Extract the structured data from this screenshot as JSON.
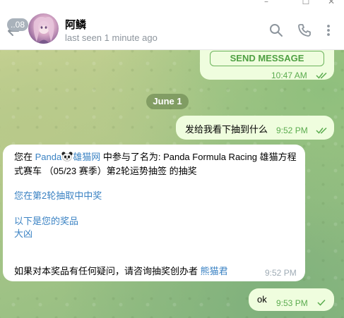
{
  "window": {
    "controls": [
      "–",
      "☐",
      "✕"
    ]
  },
  "header": {
    "unread_count": "..08",
    "chat_name": "阿鳞",
    "status": "last seen 1 minute ago"
  },
  "messages": {
    "first": {
      "button_label": "SEND MESSAGE",
      "time": "10:47 AM"
    },
    "date_separator": "June 1",
    "second": {
      "text": "发给我看下抽到什么",
      "time": "9:52 PM"
    },
    "third": {
      "line1_prefix": "您在 ",
      "line1_link1": "Panda",
      "line1_link2": "雄猫网",
      "line1_rest": " 中参与了名为: Panda Formula Racing 雄猫方程",
      "line2": "式赛车 （05/23 赛季）第2轮运势抽签 的抽奖",
      "line3": "您在第2轮抽取中中奖",
      "line4": "以下是您的奖品",
      "line5": "大凶",
      "line6_prefix": "如果对本奖品有任何疑问，请咨询抽奖创办者 ",
      "line6_link": "熊猫君",
      "time": "9:52 PM"
    },
    "fourth": {
      "text": "ok",
      "time": "9:53 PM"
    }
  },
  "colors": {
    "outgoing_bubble": "#effdde",
    "incoming_bubble": "#ffffff",
    "link": "#3a82c3",
    "accent_green": "#4fa043"
  },
  "icons": {
    "back": "back-arrow-icon",
    "search": "search-icon",
    "call": "phone-icon",
    "menu": "more-vertical-icon",
    "read": "double-check-icon",
    "sent": "single-check-icon",
    "panda": "panda-emoji-icon"
  }
}
